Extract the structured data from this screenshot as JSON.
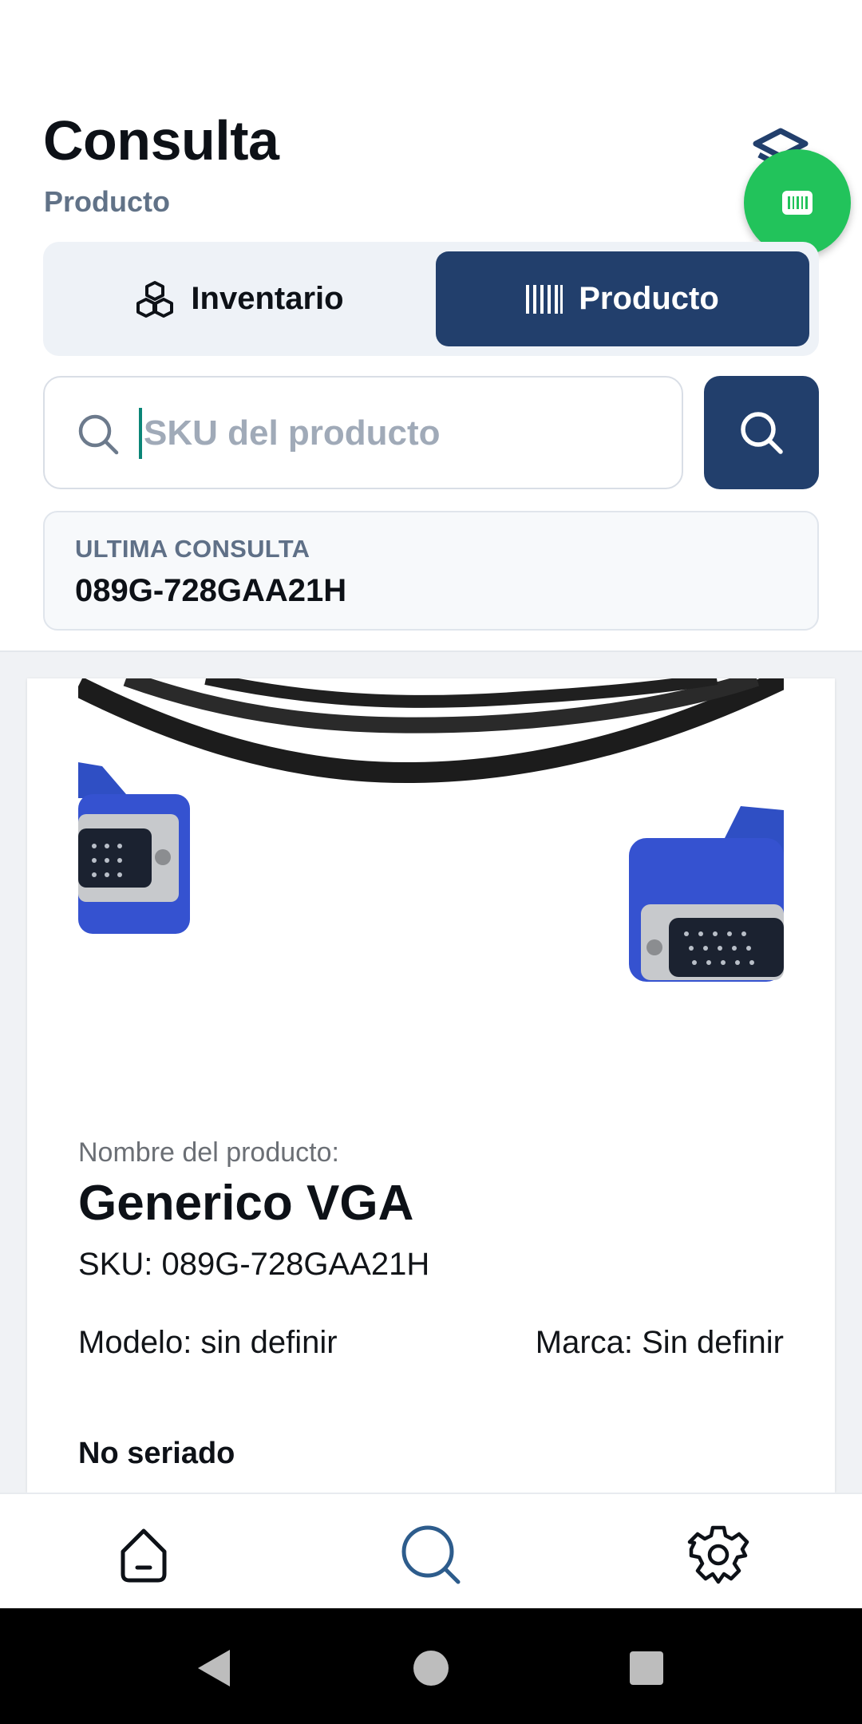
{
  "header": {
    "title": "Consulta",
    "subtitle": "Producto"
  },
  "tabs": [
    {
      "label": "Inventario",
      "icon": "cubes-icon",
      "active": false
    },
    {
      "label": "Producto",
      "icon": "barcode-icon",
      "active": true
    }
  ],
  "search": {
    "value": "",
    "placeholder": "SKU del producto"
  },
  "last_query": {
    "label": "ULTIMA CONSULTA",
    "value": "089G-728GAA21H"
  },
  "product": {
    "name_label": "Nombre del producto:",
    "name": "Generico VGA",
    "sku": "SKU: 089G-728GAA21H",
    "model": "Modelo: sin definir",
    "brand": "Marca: Sin definir",
    "serial": "No seriado"
  },
  "bottom_nav": [
    {
      "icon": "home-icon",
      "active": false
    },
    {
      "icon": "search-icon",
      "active": true
    },
    {
      "icon": "gear-icon",
      "active": false
    }
  ],
  "colors": {
    "primary": "#223f6c",
    "fab": "#22c35b",
    "muted": "#617287"
  }
}
